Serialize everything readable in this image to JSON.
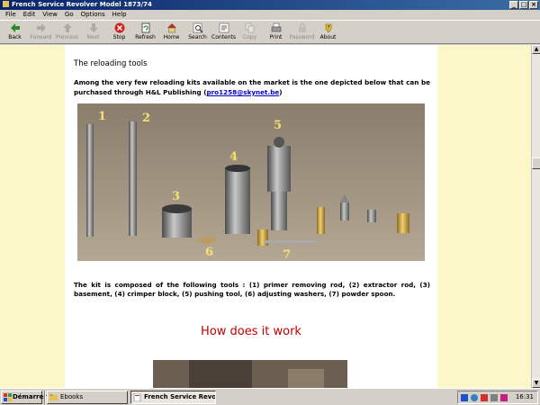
{
  "window": {
    "title": "French Service Revolver Model 1873/74"
  },
  "menu": [
    "File",
    "Edit",
    "View",
    "Go",
    "Options",
    "Help"
  ],
  "toolbar": [
    {
      "label": "Back",
      "icon": "arrow-left-icon",
      "enabled": true
    },
    {
      "label": "Forward",
      "icon": "arrow-right-icon",
      "enabled": false
    },
    {
      "label": "Previous",
      "icon": "arrow-up-icon",
      "enabled": false
    },
    {
      "label": "Next",
      "icon": "arrow-down-icon",
      "enabled": false
    },
    {
      "label": "Stop",
      "icon": "stop-icon",
      "enabled": true
    },
    {
      "label": "Refresh",
      "icon": "refresh-icon",
      "enabled": true
    },
    {
      "label": "Home",
      "icon": "home-icon",
      "enabled": true
    },
    {
      "label": "Search",
      "icon": "search-icon",
      "enabled": true
    },
    {
      "label": "Contents",
      "icon": "contents-icon",
      "enabled": true
    },
    {
      "label": "Copy",
      "icon": "copy-icon",
      "enabled": false
    },
    {
      "label": "Print",
      "icon": "print-icon",
      "enabled": true
    },
    {
      "label": "Password",
      "icon": "password-icon",
      "enabled": false
    },
    {
      "label": "About",
      "icon": "about-icon",
      "enabled": true
    }
  ],
  "page": {
    "heading": "The reloading tools",
    "intro": "Among the very few reloading kits available on the market is the one depicted below that can be purchased through H&L Publishing (",
    "intro_link": "pro1258@skynet.be",
    "intro_end": ")",
    "photo_labels": [
      "1",
      "2",
      "3",
      "4",
      "5",
      "6",
      "7"
    ],
    "kit_description": "The kit is composed of the following tools : (1) primer removing rod, (2) extractor rod, (3) basement, (4) crimper block, (5) pushing tool, (6) adjusting washers, (7) powder spoon.",
    "section_heading": "How does it work"
  },
  "taskbar": {
    "start_label": "Démarrer",
    "tasks": [
      {
        "label": "Ebooks",
        "active": false
      },
      {
        "label": "French Service Revol...",
        "active": true
      }
    ],
    "clock": "16:31"
  },
  "colors": {
    "page_background": "#fbf7c8",
    "content_background": "#ffffff",
    "section_heading": "#c00000",
    "link": "#0000cc"
  }
}
